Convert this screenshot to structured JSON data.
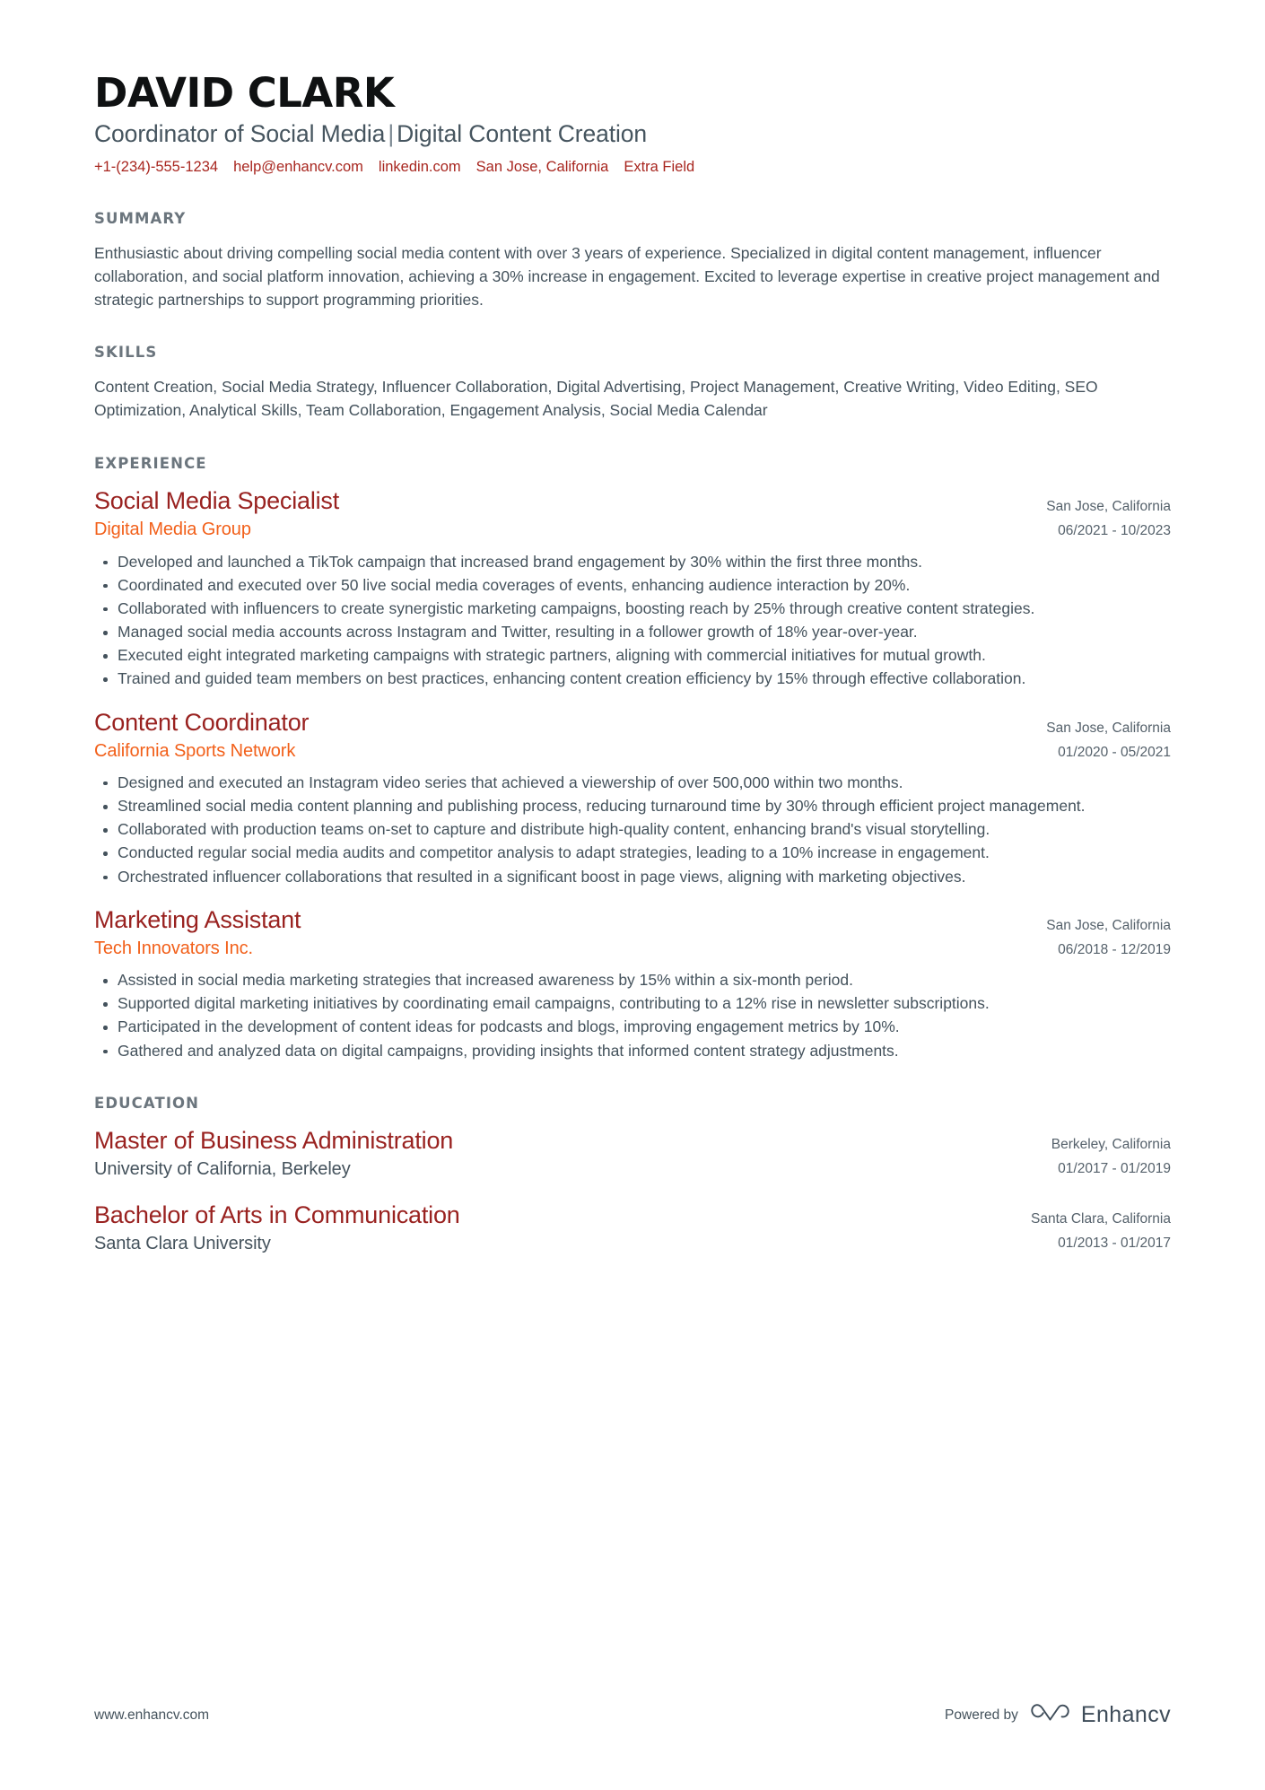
{
  "header": {
    "name": "DAVID CLARK",
    "headline_left": "Coordinator of Social Media",
    "headline_sep": "|",
    "headline_right": "Digital Content Creation",
    "contact": {
      "phone": "+1-(234)-555-1234",
      "email": "help@enhancv.com",
      "linkedin": "linkedin.com",
      "location": "San Jose, California",
      "extra": "Extra Field"
    },
    "accent_color": "#a8261f"
  },
  "summary": {
    "title": "SUMMARY",
    "text": "Enthusiastic about driving compelling social media content with over 3 years of experience. Specialized in digital content management, influencer collaboration, and social platform innovation, achieving a 30% increase in engagement. Excited to leverage expertise in creative project management and strategic partnerships to support programming priorities."
  },
  "skills": {
    "title": "SKILLS",
    "text": "Content Creation, Social Media Strategy, Influencer Collaboration, Digital Advertising, Project Management, Creative Writing, Video Editing, SEO Optimization, Analytical Skills, Team Collaboration, Engagement Analysis, Social Media Calendar"
  },
  "experience": {
    "title": "EXPERIENCE",
    "entries": [
      {
        "role": "Social Media Specialist",
        "company": "Digital Media Group",
        "location": "San Jose, California",
        "dates": "06/2021 - 10/2023",
        "bullets": [
          "Developed and launched a TikTok campaign that increased brand engagement by 30% within the first three months.",
          "Coordinated and executed over 50 live social media coverages of events, enhancing audience interaction by 20%.",
          "Collaborated with influencers to create synergistic marketing campaigns, boosting reach by 25% through creative content strategies.",
          "Managed social media accounts across Instagram and Twitter, resulting in a follower growth of 18% year-over-year.",
          "Executed eight integrated marketing campaigns with strategic partners, aligning with commercial initiatives for mutual growth.",
          "Trained and guided team members on best practices, enhancing content creation efficiency by 15% through effective collaboration."
        ]
      },
      {
        "role": "Content Coordinator",
        "company": "California Sports Network",
        "location": "San Jose, California",
        "dates": "01/2020 - 05/2021",
        "bullets": [
          "Designed and executed an Instagram video series that achieved a viewership of over 500,000 within two months.",
          "Streamlined social media content planning and publishing process, reducing turnaround time by 30% through efficient project management.",
          "Collaborated with production teams on-set to capture and distribute high-quality content, enhancing brand's visual storytelling.",
          "Conducted regular social media audits and competitor analysis to adapt strategies, leading to a 10% increase in engagement.",
          "Orchestrated influencer collaborations that resulted in a significant boost in page views, aligning with marketing objectives."
        ]
      },
      {
        "role": "Marketing Assistant",
        "company": "Tech Innovators Inc.",
        "location": "San Jose, California",
        "dates": "06/2018 - 12/2019",
        "bullets": [
          "Assisted in social media marketing strategies that increased awareness by 15% within a six-month period.",
          "Supported digital marketing initiatives by coordinating email campaigns, contributing to a 12% rise in newsletter subscriptions.",
          "Participated in the development of content ideas for podcasts and blogs, improving engagement metrics by 10%.",
          "Gathered and analyzed data on digital campaigns, providing insights that informed content strategy adjustments."
        ]
      }
    ]
  },
  "education": {
    "title": "EDUCATION",
    "entries": [
      {
        "degree": "Master of Business Administration",
        "school": "University of California, Berkeley",
        "location": "Berkeley, California",
        "dates": "01/2017 - 01/2019"
      },
      {
        "degree": "Bachelor of Arts in Communication",
        "school": "Santa Clara University",
        "location": "Santa Clara, California",
        "dates": "01/2013 - 01/2017"
      }
    ]
  },
  "footer": {
    "url": "www.enhancv.com",
    "powered_by": "Powered by",
    "brand": "Enhancv"
  }
}
